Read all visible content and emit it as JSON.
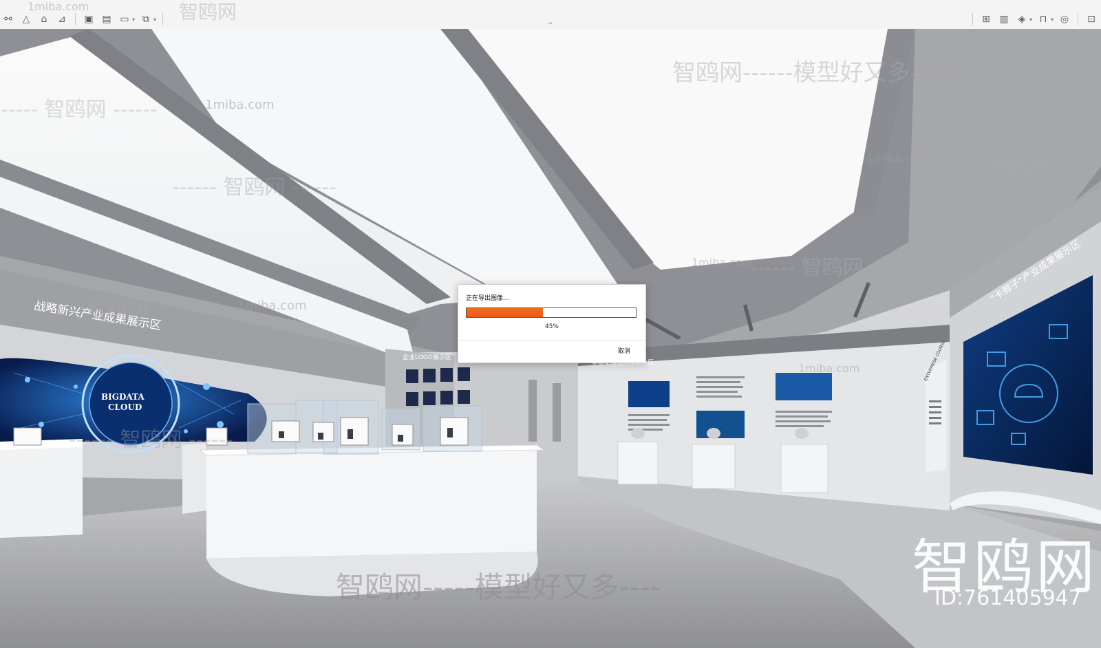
{
  "toolbar": {
    "left_icons": [
      "binoculars-icon",
      "pyramid-icon",
      "house-icon",
      "stairs-icon",
      "render-icon",
      "render-frame-icon",
      "render-setup-icon",
      "render-export-icon"
    ],
    "right_icons": [
      "map-icon",
      "monitor-icon",
      "shield-icon",
      "bookmark-icon",
      "snapshot-icon"
    ],
    "collapse_glyph": "⌃"
  },
  "watermarks": {
    "top_small": "1miba.com",
    "top_large": "智鸥网",
    "site_small_1": "1miba.com",
    "site_small_2": "1miba.com",
    "site_small_3": "1miba.com",
    "site_small_4": "1miba.com",
    "site_small_5": "1miba.com",
    "slogan_1": "智鸥网------模型好又多------",
    "slogan_2": "------ 智鸥网 ------",
    "slogan_3": "------ 智鸥网 ------",
    "slogan_4": "------ 智鸥网",
    "slogan_5": "------ 智鸥网 ------",
    "slogan_6": "智鸥网",
    "slogan_7": "------ 智鸥网 ------",
    "bottom_slogan": "智鸥网-----模型好又多----",
    "brand": "智鸥网",
    "id": "ID:761405947"
  },
  "scene": {
    "sign_left": "战略新兴产业成果展示区",
    "sign_logo": "企业LOGO展示区",
    "sign_health": "生命大健康成果展示区",
    "sign_right": "\"卡脖子\"产业成果展示区",
    "bigdata_line1": "BIGDATA",
    "bigdata_line2": "CLOUD",
    "enterprise_label": "ENTERPRISE COURSE"
  },
  "dialog": {
    "title": "正在导出图像...",
    "progress": 0.45,
    "percent_label": "45%",
    "cancel_label": "取消",
    "fill_color": "#f06420"
  }
}
